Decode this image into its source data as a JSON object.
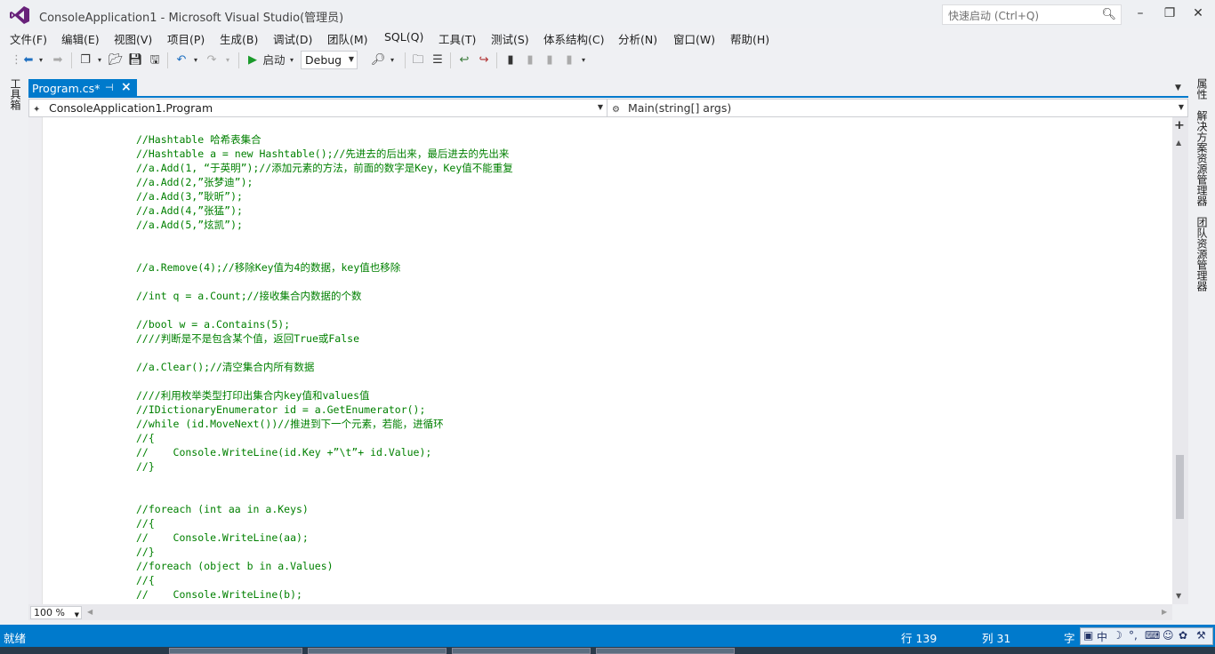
{
  "window": {
    "title": "ConsoleApplication1 - Microsoft Visual Studio(管理员)",
    "quick_launch_placeholder": "快速启动 (Ctrl+Q)"
  },
  "menu": [
    "文件(F)",
    "编辑(E)",
    "视图(V)",
    "项目(P)",
    "生成(B)",
    "调试(D)",
    "团队(M)",
    "SQL(Q)",
    "工具(T)",
    "测试(S)",
    "体系结构(C)",
    "分析(N)",
    "窗口(W)",
    "帮助(H)"
  ],
  "toolbar": {
    "start_label": "启动",
    "config_value": "Debug"
  },
  "side_left": {
    "toolbox_label": "工具箱"
  },
  "side_right": {
    "properties_label": "属性",
    "solution_explorer_label": "解决方案资源管理器",
    "team_explorer_label": "团队资源管理器"
  },
  "document_tab": {
    "label": "Program.cs*"
  },
  "navbar": {
    "class_value": "ConsoleApplication1.Program",
    "member_value": "Main(string[] args)"
  },
  "code_lines": [
    "//Hashtable 哈希表集合",
    "//Hashtable a = new Hashtable();//先进去的后出来，最后进去的先出来",
    "//a.Add(1, “于英明”);//添加元素的方法，前面的数字是Key，Key值不能重复",
    "//a.Add(2,”张梦迪”);",
    "//a.Add(3,”耿昕”);",
    "//a.Add(4,”张猛”);",
    "//a.Add(5,”炫凯”);",
    "",
    "",
    "//a.Remove(4);//移除Key值为4的数据，key值也移除",
    "",
    "//int q = a.Count;//接收集合内数据的个数",
    "",
    "//bool w = a.Contains(5);",
    "////判断是不是包含某个值，返回True或False",
    "",
    "//a.Clear();//清空集合内所有数据",
    "",
    "////利用枚举类型打印出集合内key值和values值",
    "//IDictionaryEnumerator id = a.GetEnumerator();",
    "//while (id.MoveNext())//推进到下一个元素，若能，进循环",
    "//{",
    "//    Console.WriteLine(id.Key +”\\t”+ id.Value);",
    "//}",
    "",
    "",
    "//foreach (int aa in a.Keys)",
    "//{",
    "//    Console.WriteLine(aa);",
    "//}",
    "//foreach (object b in a.Values)",
    "//{",
    "//    Console.WriteLine(b);"
  ],
  "zoom": "100 %",
  "status": {
    "state": "就绪",
    "line": "行 139",
    "col": "列 31",
    "char_prefix": "字"
  },
  "ime": {
    "lang": "中"
  }
}
